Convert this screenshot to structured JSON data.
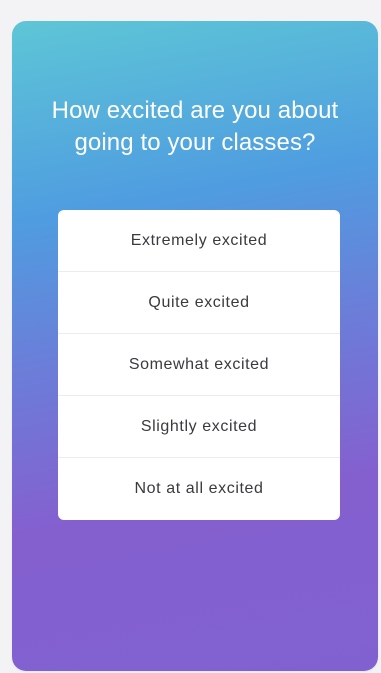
{
  "question": "How excited are you about going to your classes?",
  "options": [
    {
      "label": "Extremely excited"
    },
    {
      "label": "Quite excited"
    },
    {
      "label": "Somewhat excited"
    },
    {
      "label": "Slightly excited"
    },
    {
      "label": "Not at all excited"
    }
  ],
  "colors": {
    "gradient_top": "#5ec6d6",
    "gradient_mid": "#4f9de0",
    "gradient_bottom": "#8161d0",
    "option_background": "#ffffff",
    "option_text": "#3a3a3f",
    "question_text": "#ffffff"
  }
}
